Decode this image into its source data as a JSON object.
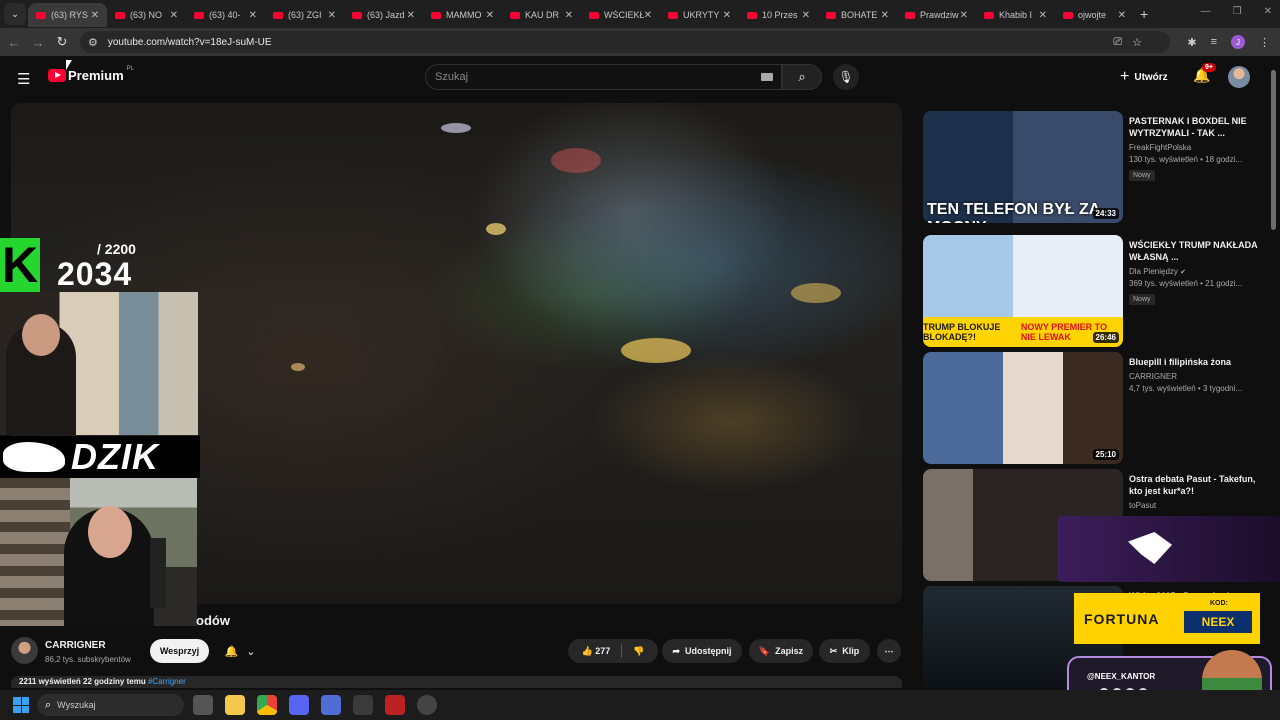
{
  "browser": {
    "tabs": [
      {
        "title": "(63) RYS",
        "active": true
      },
      {
        "title": "(63) NO",
        "active": false
      },
      {
        "title": "(63) 40-",
        "active": false
      },
      {
        "title": "(63) ZGI",
        "active": false
      },
      {
        "title": "(63) Jazd",
        "active": false
      },
      {
        "title": "MAMMO",
        "active": false
      },
      {
        "title": "KAU DR",
        "active": false
      },
      {
        "title": "WŚCIEKŁ",
        "active": false
      },
      {
        "title": "UKRYTY",
        "active": false
      },
      {
        "title": "10 Przes",
        "active": false
      },
      {
        "title": "BOHATE",
        "active": false
      },
      {
        "title": "Prawdziw",
        "active": false
      },
      {
        "title": "Khabib I",
        "active": false
      },
      {
        "title": "ojwojte",
        "active": false
      }
    ],
    "new_tab": "+",
    "url": "youtube.com/watch?v=18eJ-suM-UE",
    "profile_initial": "J"
  },
  "header": {
    "logo_text": "Premium",
    "logo_region": "PL",
    "search_placeholder": "Szukaj",
    "create_label": "Utwórz",
    "notifications_badge": "9+"
  },
  "overlay": {
    "counter_max": "/ 2200",
    "counter_now": "2034",
    "k_letter": "K",
    "dzik_text": "DZIK"
  },
  "video": {
    "title_fragment": "odów",
    "channel_name": "CARRIGNER",
    "channel_subs": "86,2 tys. subskrybentów",
    "support_label": "Wesprzyj",
    "likes": "277",
    "share_label": "Udostępnij",
    "save_label": "Zapisz",
    "clip_label": "Klip",
    "description_meta": "2211 wyświetleń  22 godziny temu",
    "description_tag": "#Carrigner"
  },
  "recommendations": [
    {
      "title": "PASTERNAK I BOXDEL NIE WYTRZYMALI - TAK ...",
      "channel": "FreakFightPolska",
      "meta": "130 tys. wyświetleń • 18 godzi...",
      "badge": "Nowy",
      "duration": "24:33",
      "thumb_caption": "TEN TELEFON BYŁ ZA MOCNY"
    },
    {
      "title": "WŚCIEKŁY TRUMP NAKŁADA WŁASNĄ ...",
      "channel": "Dla Pieniędzy",
      "meta": "369 tys. wyświetleń • 21 godzi...",
      "badge": "Nowy",
      "duration": "26:46",
      "thumb_caption_left": "TRUMP BLOKUJE BLOKADĘ?!",
      "thumb_caption_right": "NOWY PREMIER TO NIE LEWAK"
    },
    {
      "title": "Bluepill i filipińska żona",
      "channel": "CARRIGNER",
      "meta": "4,7 tys. wyświetleń • 3 tygodni...",
      "badge": "",
      "duration": "25:10"
    },
    {
      "title": "Ostra debata Pasut - Takefun, kto jest kur*a?!",
      "channel": "toPasut",
      "meta": "",
      "badge": "",
      "duration": ""
    },
    {
      "title": "White 2115 - Do zachodu",
      "channel": "",
      "meta": "",
      "badge": "",
      "duration": ""
    }
  ],
  "ads": {
    "fortuna": "FORTUNA",
    "code_label": "KOD:",
    "code": "NEEX",
    "kantor_handle": "@NEEX_KANTOR"
  },
  "taskbar": {
    "search_label": "Wyszukaj"
  },
  "colors": {
    "youtube_red": "#ff0033",
    "k_green": "#25d62f",
    "fortuna_yellow": "#ffd200"
  }
}
